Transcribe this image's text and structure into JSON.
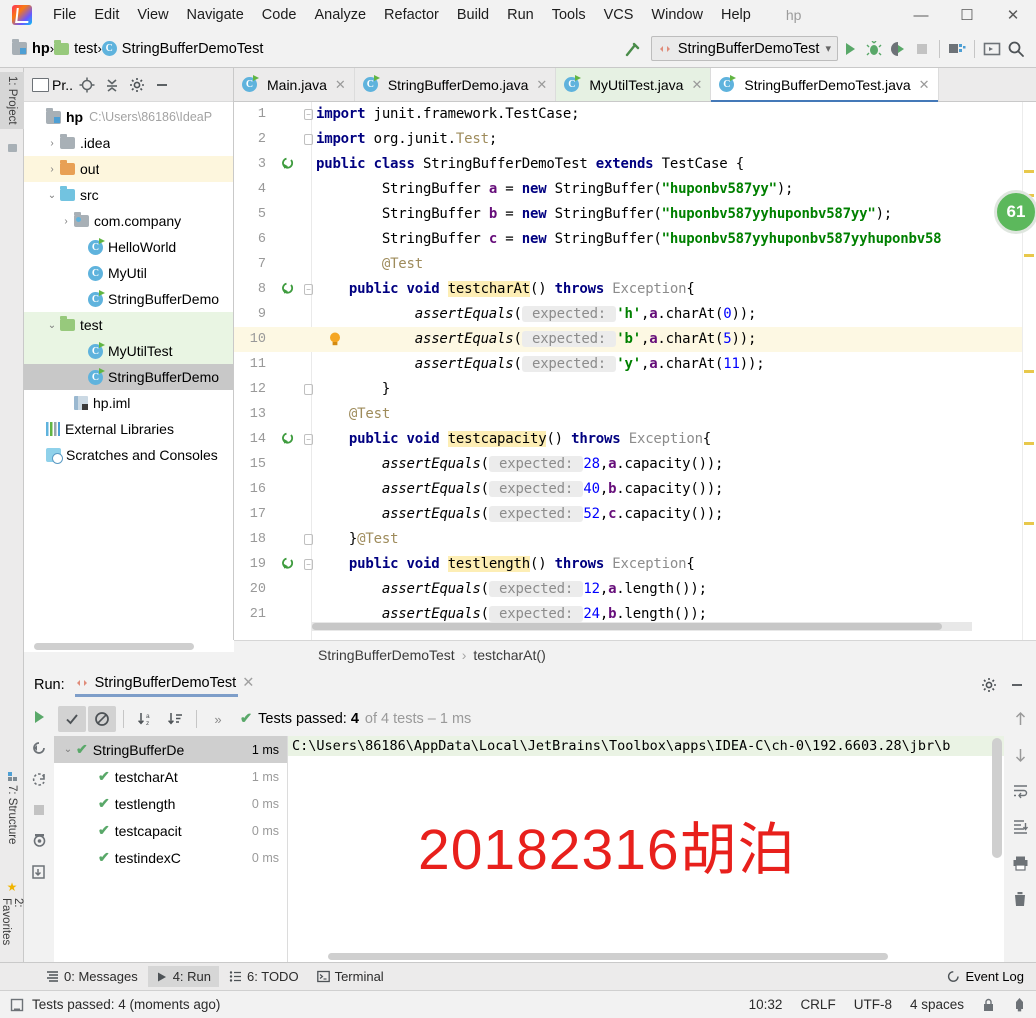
{
  "window": {
    "project_name": "hp",
    "minimize": "—",
    "maximize": "☐",
    "close": "✕"
  },
  "menubar": {
    "items": [
      {
        "label": "File"
      },
      {
        "label": "Edit"
      },
      {
        "label": "View"
      },
      {
        "label": "Navigate"
      },
      {
        "label": "Code"
      },
      {
        "label": "Analyze"
      },
      {
        "label": "Refactor"
      },
      {
        "label": "Build"
      },
      {
        "label": "Run"
      },
      {
        "label": "Tools"
      },
      {
        "label": "VCS"
      },
      {
        "label": "Window"
      },
      {
        "label": "Help"
      }
    ]
  },
  "navbar": {
    "breadcrumbs": [
      {
        "label": "hp",
        "icon": "module-icon"
      },
      {
        "label": "test",
        "icon": "folder-icon"
      },
      {
        "label": "StringBufferDemoTest",
        "icon": "class-icon"
      }
    ],
    "separator": "›",
    "run_config": "StringBufferDemoTest",
    "toolbar_icons": [
      "build-hammer-icon",
      "run-icon",
      "debug-icon",
      "run-with-coverage-icon",
      "stop-icon",
      "project-structure-icon",
      "open-terminal-icon",
      "search-everywhere-icon"
    ]
  },
  "left_stripe": {
    "project_tab": "1: Project",
    "structure_tab": "7: Structure",
    "favorites_tab": "2: Favorites"
  },
  "project_panel": {
    "title": "Pr..",
    "header_icons": [
      "locate-icon",
      "collapse-all-icon",
      "settings-gear-icon",
      "hide-icon"
    ],
    "tree": [
      {
        "label": "hp",
        "path": "C:\\Users\\86186\\IdeaP",
        "icon": "module-icon",
        "indent": 0,
        "arrow": "",
        "bold": true,
        "state": "none"
      },
      {
        "label": ".idea",
        "path": "",
        "icon": "folder-gray-icon",
        "indent": 1,
        "arrow": "›",
        "bold": false,
        "state": "none"
      },
      {
        "label": "out",
        "path": "",
        "icon": "folder-orange-icon",
        "indent": 1,
        "arrow": "›",
        "bold": false,
        "state": "hl-yellow"
      },
      {
        "label": "src",
        "path": "",
        "icon": "folder-blue-icon",
        "indent": 1,
        "arrow": "⌄",
        "bold": false,
        "state": "none"
      },
      {
        "label": "com.company",
        "path": "",
        "icon": "package-icon",
        "indent": 2,
        "arrow": "›",
        "bold": false,
        "state": "none"
      },
      {
        "label": "HelloWorld",
        "path": "",
        "icon": "class-runnable-icon",
        "indent": 3,
        "arrow": "",
        "bold": false,
        "state": "none"
      },
      {
        "label": "MyUtil",
        "path": "",
        "icon": "class-icon",
        "indent": 3,
        "arrow": "",
        "bold": false,
        "state": "none"
      },
      {
        "label": "StringBufferDemo",
        "path": "",
        "icon": "class-runnable-icon",
        "indent": 3,
        "arrow": "",
        "bold": false,
        "state": "none"
      },
      {
        "label": "test",
        "path": "",
        "icon": "folder-green-icon",
        "indent": 1,
        "arrow": "⌄",
        "bold": false,
        "state": "hl-green"
      },
      {
        "label": "MyUtilTest",
        "path": "",
        "icon": "class-runnable-icon",
        "indent": 3,
        "arrow": "",
        "bold": false,
        "state": "hl-green"
      },
      {
        "label": "StringBufferDemo",
        "path": "",
        "icon": "class-runnable-icon",
        "indent": 3,
        "arrow": "",
        "bold": false,
        "state": "sel"
      },
      {
        "label": "hp.iml",
        "path": "",
        "icon": "iml-file-icon",
        "indent": 2,
        "arrow": "",
        "bold": false,
        "state": "none"
      },
      {
        "label": "External Libraries",
        "path": "",
        "icon": "libraries-icon",
        "indent": 0,
        "arrow": "",
        "bold": false,
        "state": "none"
      },
      {
        "label": "Scratches and Consoles",
        "path": "",
        "icon": "scratches-icon",
        "indent": 0,
        "arrow": "",
        "bold": false,
        "state": "none"
      }
    ]
  },
  "editor": {
    "tabs": [
      {
        "label": "Main.java",
        "state": "inactive"
      },
      {
        "label": "StringBufferDemo.java",
        "state": "inactive"
      },
      {
        "label": "MyUtilTest.java",
        "state": "other-active"
      },
      {
        "label": "StringBufferDemoTest.java",
        "state": "active"
      }
    ],
    "inspection_badge": "61",
    "breadcrumb": {
      "class": "StringBufferDemoTest",
      "separator": "›",
      "method": "testcharAt()"
    },
    "lines": [
      {
        "no": "1",
        "state": "none",
        "marker": "",
        "fold": "top",
        "html": "<span class=\"kw\">import</span> junit.framework.TestCase;"
      },
      {
        "no": "2",
        "state": "none",
        "marker": "",
        "fold": "bot",
        "html": "<span class=\"kw\">import</span> org.junit.<span class=\"anno\">Test</span>;"
      },
      {
        "no": "3",
        "state": "none",
        "marker": "run",
        "fold": "",
        "html": "<span class=\"kw\">public class</span> StringBufferDemoTest <span class=\"kw\">extends</span> TestCase {"
      },
      {
        "no": "4",
        "state": "none",
        "marker": "",
        "fold": "",
        "html": "        StringBuffer <span class=\"field\">a</span> = <span class=\"kw\">new</span> StringBuffer(<span class=\"str\">\"huponbv587yy\"</span>);"
      },
      {
        "no": "5",
        "state": "none",
        "marker": "",
        "fold": "",
        "html": "        StringBuffer <span class=\"field\">b</span> = <span class=\"kw\">new</span> StringBuffer(<span class=\"str\">\"huponbv587yyhuponbv587yy\"</span>);"
      },
      {
        "no": "6",
        "state": "none",
        "marker": "",
        "fold": "",
        "html": "        StringBuffer <span class=\"field\">c</span> = <span class=\"kw\">new</span> StringBuffer(<span class=\"str\">\"huponbv587yyhuponbv587yyhuponbv58</span>"
      },
      {
        "no": "7",
        "state": "none",
        "marker": "",
        "fold": "",
        "html": "        <span class=\"anno\">@Test</span>"
      },
      {
        "no": "8",
        "state": "none",
        "marker": "run",
        "fold": "top",
        "html": "    <span class=\"kw\">public void</span> <span class=\"hlident\">testcharAt</span>() <span class=\"kw\">throws</span> <span class=\"gray\">Exception</span>{"
      },
      {
        "no": "9",
        "state": "none",
        "marker": "",
        "fold": "",
        "html": "            <span class=\"italic\">assertEquals</span>(<span class=\"paramhint\"> expected: </span><span class=\"chartlit\">'h'</span>,<span class=\"field\">a</span>.charAt(<span class=\"num\">0</span>));"
      },
      {
        "no": "10",
        "state": "hl",
        "marker": "bulb",
        "fold": "",
        "html": "            <span class=\"italic\">assertEquals</span>(<span class=\"paramhint\"> expected: </span><span class=\"chartlit\">'b'</span>,<span class=\"field\">a</span>.charAt(<span class=\"num\">5</span>));"
      },
      {
        "no": "11",
        "state": "none",
        "marker": "",
        "fold": "",
        "html": "            <span class=\"italic\">assertEquals</span>(<span class=\"paramhint\"> expected: </span><span class=\"chartlit\">'y'</span>,<span class=\"field\">a</span>.charAt(<span class=\"num\">11</span>));"
      },
      {
        "no": "12",
        "state": "none",
        "marker": "",
        "fold": "bot",
        "html": "        }"
      },
      {
        "no": "13",
        "state": "none",
        "marker": "",
        "fold": "",
        "html": "    <span class=\"anno\">@Test</span>"
      },
      {
        "no": "14",
        "state": "none",
        "marker": "run",
        "fold": "top",
        "html": "    <span class=\"kw\">public void</span> <span class=\"hlident\">testcapacity</span>() <span class=\"kw\">throws</span> <span class=\"gray\">Exception</span>{"
      },
      {
        "no": "15",
        "state": "none",
        "marker": "",
        "fold": "",
        "html": "        <span class=\"italic\">assertEquals</span>(<span class=\"paramhint\"> expected: </span><span class=\"num\">28</span>,<span class=\"field\">a</span>.capacity());"
      },
      {
        "no": "16",
        "state": "none",
        "marker": "",
        "fold": "",
        "html": "        <span class=\"italic\">assertEquals</span>(<span class=\"paramhint\"> expected: </span><span class=\"num\">40</span>,<span class=\"field\">b</span>.capacity());"
      },
      {
        "no": "17",
        "state": "none",
        "marker": "",
        "fold": "",
        "html": "        <span class=\"italic\">assertEquals</span>(<span class=\"paramhint\"> expected: </span><span class=\"num\">52</span>,<span class=\"field\">c</span>.capacity());"
      },
      {
        "no": "18",
        "state": "none",
        "marker": "",
        "fold": "bot",
        "html": "    }<span class=\"anno\">@Test</span>"
      },
      {
        "no": "19",
        "state": "none",
        "marker": "run",
        "fold": "top",
        "html": "    <span class=\"kw\">public void</span> <span class=\"hlident\">testlength</span>() <span class=\"kw\">throws</span> <span class=\"gray\">Exception</span>{"
      },
      {
        "no": "20",
        "state": "none",
        "marker": "",
        "fold": "",
        "html": "        <span class=\"italic\">assertEquals</span>(<span class=\"paramhint\"> expected: </span><span class=\"num\">12</span>,<span class=\"field\">a</span>.length());"
      },
      {
        "no": "21",
        "state": "none",
        "marker": "",
        "fold": "",
        "html": "        <span class=\"italic\">assertEquals</span>(<span class=\"paramhint\"> expected: </span><span class=\"num\">24</span>,<span class=\"field\">b</span>.length());"
      }
    ]
  },
  "run_panel": {
    "run_label": "Run:",
    "tab_label": "StringBufferDemoTest",
    "toolbar_icons": [
      "rerun-icon",
      "rerun-failed-icon",
      "stop-icon-left",
      "export-icon",
      "show-passed-icon",
      "hide-ignored-icon",
      "sort-alphabetically-icon",
      "sort-by-duration-icon"
    ],
    "expand_label": "»",
    "status": {
      "passed_prefix": "Tests passed: ",
      "passed_count": "4",
      "suffix": "of 4 tests – 1 ms"
    },
    "tests": [
      {
        "name": "StringBufferDe",
        "time": "1 ms",
        "level": 0,
        "selected": true,
        "arrow": "⌄"
      },
      {
        "name": "testcharAt",
        "time": "1 ms",
        "level": 1,
        "selected": false,
        "arrow": ""
      },
      {
        "name": "testlength",
        "time": "0 ms",
        "level": 1,
        "selected": false,
        "arrow": ""
      },
      {
        "name": "testcapacit",
        "time": "0 ms",
        "level": 1,
        "selected": false,
        "arrow": ""
      },
      {
        "name": "testindexC",
        "time": "0 ms",
        "level": 1,
        "selected": false,
        "arrow": ""
      }
    ],
    "console_line": "C:\\Users\\86186\\AppData\\Local\\JetBrains\\Toolbox\\apps\\IDEA-C\\ch-0\\192.6603.28\\jbr\\b",
    "watermark": "20182316胡泊",
    "watermark_color": "#e8201c",
    "right_icons": [
      "scroll-up-icon",
      "scroll-down-icon",
      "soft-wrap-icon",
      "scroll-to-end-icon",
      "print-icon",
      "clear-all-icon"
    ]
  },
  "toolwindow_bar": {
    "items": [
      {
        "label": "0: Messages",
        "icon": "messages-icon",
        "selected": false
      },
      {
        "label": "4: Run",
        "icon": "run-triangle-icon",
        "selected": true
      },
      {
        "label": "6: TODO",
        "icon": "todo-icon",
        "selected": false
      },
      {
        "label": "Terminal",
        "icon": "terminal-icon",
        "selected": false
      }
    ],
    "event_log": "Event Log",
    "event_log_icon": "event-log-icon"
  },
  "statusbar": {
    "message": "Tests passed: 4 (moments ago)",
    "message_icon": "memory-icon",
    "time": "10:32",
    "line_separator": "CRLF",
    "encoding": "UTF-8",
    "indent": "4 spaces",
    "lock_icon": "lock-icon",
    "inspection_icon": "inspection-icon"
  }
}
